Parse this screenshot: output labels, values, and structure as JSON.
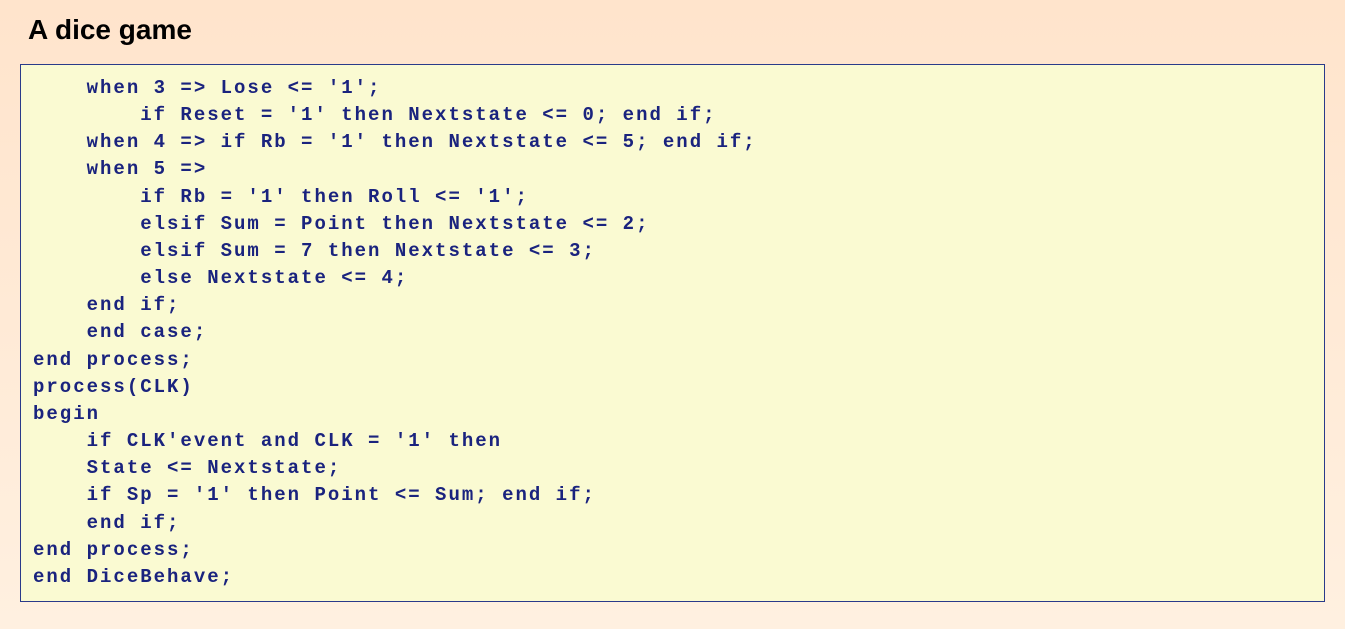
{
  "title": "A dice game",
  "code_lines": [
    "    when 3 => Lose <= '1';",
    "        if Reset = '1' then Nextstate <= 0; end if;",
    "    when 4 => if Rb = '1' then Nextstate <= 5; end if;",
    "    when 5 =>",
    "        if Rb = '1' then Roll <= '1';",
    "        elsif Sum = Point then Nextstate <= 2;",
    "        elsif Sum = 7 then Nextstate <= 3;",
    "        else Nextstate <= 4;",
    "    end if;",
    "    end case;",
    "end process;",
    "process(CLK)",
    "begin",
    "    if CLK'event and CLK = '1' then",
    "    State <= Nextstate;",
    "    if Sp = '1' then Point <= Sum; end if;",
    "    end if;",
    "end process;",
    "end DiceBehave;"
  ]
}
